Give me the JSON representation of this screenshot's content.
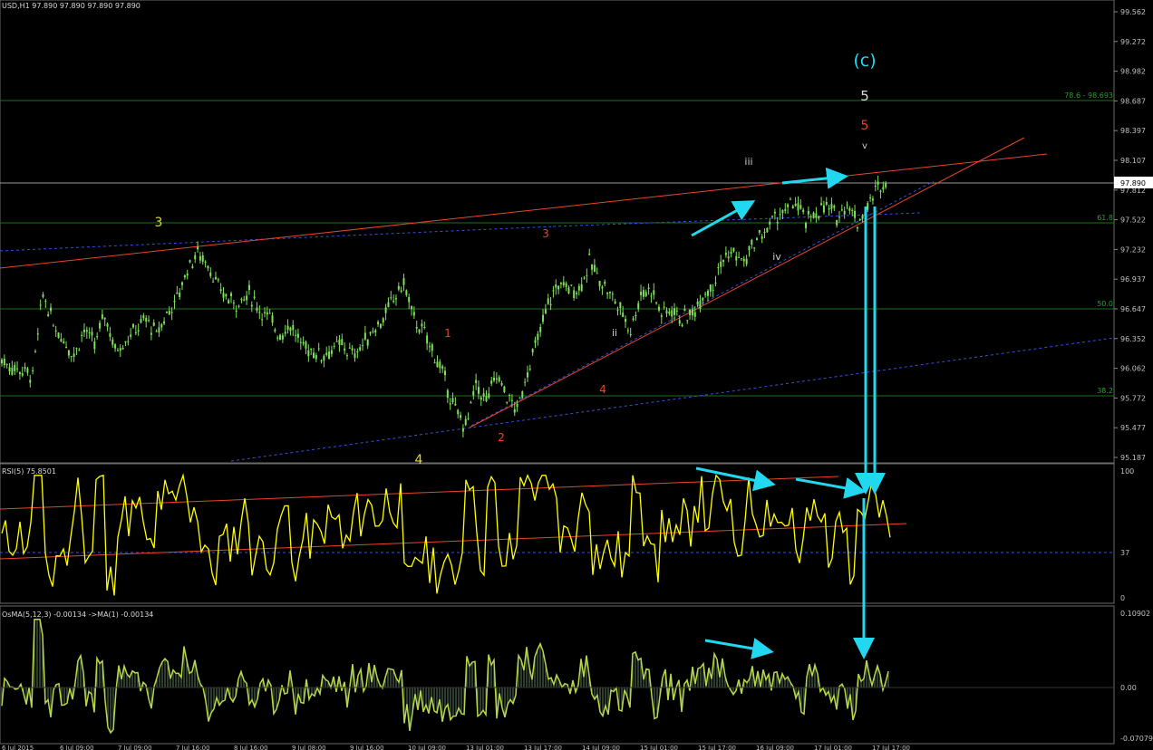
{
  "header": {
    "main_title": "USD,H1  97.890 97.890 97.890 97.890",
    "rsi_title": "RSI(5) 75.8501",
    "osma_title": "OsMA(5,12,3) -0.00134  ->MA(1) -0.00134"
  },
  "price_axis": {
    "ticks": [
      "99.562",
      "99.272",
      "98.982",
      "98.687",
      "98.397",
      "98.107",
      "97.812",
      "97.522",
      "97.232",
      "96.937",
      "96.647",
      "96.352",
      "96.062",
      "95.772",
      "95.477",
      "95.187"
    ],
    "current_price": "97.890"
  },
  "rsi_axis": {
    "ticks": [
      "100",
      "37",
      "0"
    ]
  },
  "osma_axis": {
    "ticks": [
      "0.10902",
      "0.00",
      "-0.07079"
    ]
  },
  "time_axis": {
    "ticks": [
      "6 Jul 2015",
      "6 Jul 09:00",
      "7 Jul 09:00",
      "7 Jul 16:00",
      "8 Jul 16:00",
      "9 Jul 08:00",
      "9 Jul 16:00",
      "10 Jul 09:00",
      "13 Jul 01:00",
      "13 Jul 17:00",
      "14 Jul 09:00",
      "15 Jul 01:00",
      "15 Jul 17:00",
      "16 Jul 09:00",
      "17 Jul 01:00",
      "17 Jul 17:00"
    ]
  },
  "fib_levels": {
    "l786": "78.6 - 98.693",
    "l618": "61.8",
    "l500": "50.0",
    "l382": "38.2"
  },
  "wave_labels": {
    "c": "(c)",
    "five_white": "5",
    "five_red": "5",
    "v": "v",
    "iii": "iii",
    "iv": "iv",
    "ii": "ii",
    "three_yellow": "3",
    "four_yellow": "4",
    "one_red": "1",
    "two_red": "2",
    "three_red": "3",
    "four_red": "4"
  },
  "colors": {
    "background": "#000000",
    "candles": "#7fe05a",
    "rsi_line": "#ffff00",
    "osma_line": "#b8d84a",
    "trendline": "#e8452a",
    "fib": "#1f7a1f",
    "dotted": "#3a4fd8",
    "arrow": "#22d8f0",
    "axis_text": "#c0c0c0"
  },
  "chart_data": {
    "type": "line",
    "series": [
      {
        "name": "USD,H1",
        "values": [
          96.15,
          96.08,
          96.05,
          96.0,
          96.8,
          96.5,
          96.35,
          96.2,
          96.45,
          96.3,
          96.6,
          96.25,
          96.35,
          96.45,
          96.55,
          96.4,
          96.6,
          96.75,
          97.05,
          97.2,
          97.1,
          96.85,
          96.75,
          96.7,
          96.8,
          96.65,
          96.55,
          96.4,
          96.5,
          96.3,
          96.25,
          96.2,
          96.25,
          96.3,
          96.2,
          96.3,
          96.45,
          96.55,
          96.75,
          96.9,
          96.55,
          96.4,
          96.2,
          95.95,
          95.65,
          95.5,
          95.9,
          95.75,
          96.0,
          95.8,
          95.65,
          96.05,
          96.35,
          96.7,
          96.9,
          96.85,
          96.85,
          97.1,
          96.95,
          96.8,
          96.65,
          96.45,
          96.8,
          96.85,
          96.6,
          96.65,
          96.55,
          96.6,
          96.8,
          96.9,
          97.15,
          97.2,
          97.1,
          97.3,
          97.4,
          97.55,
          97.6,
          97.7,
          97.5,
          97.6,
          97.65,
          97.55,
          97.7,
          97.5,
          97.65,
          97.85,
          97.9
        ]
      }
    ]
  }
}
